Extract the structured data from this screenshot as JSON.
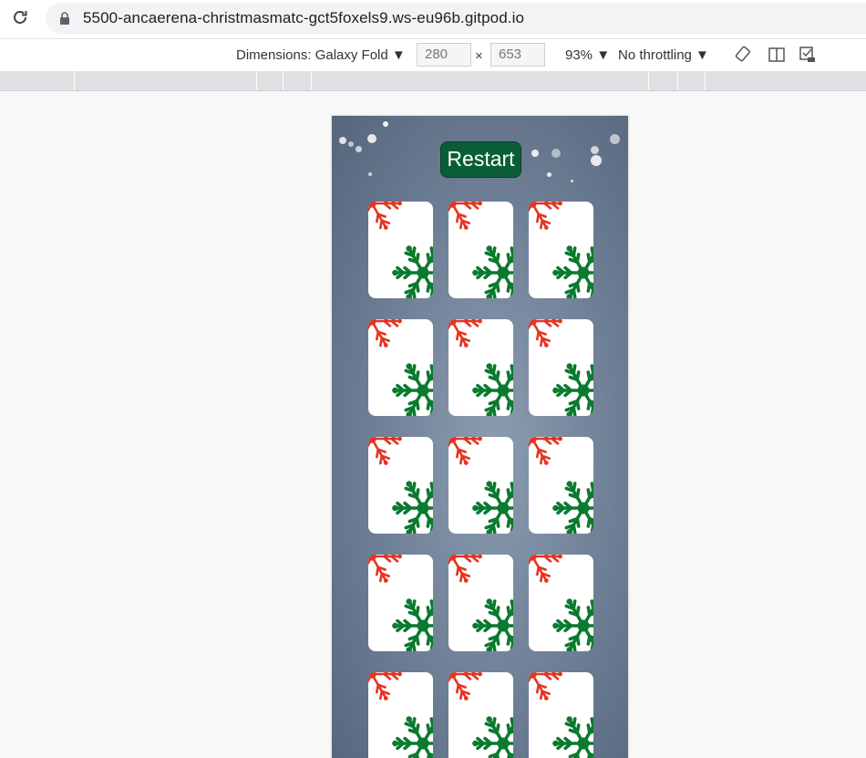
{
  "browser": {
    "url": "5500-ancaerena-christmasmatc-gct5foxels9.ws-eu96b.gitpod.io"
  },
  "device_toolbar": {
    "dimensions_label": "Dimensions: Galaxy Fold",
    "width": "280",
    "height": "653",
    "times": "×",
    "zoom": "93%",
    "throttling": "No throttling"
  },
  "game": {
    "restart_label": "Restart",
    "cards": [
      "card-back",
      "card-back",
      "card-back",
      "card-back",
      "card-back",
      "card-back",
      "card-back",
      "card-back",
      "card-back",
      "card-back",
      "card-back",
      "card-back",
      "card-back",
      "card-back",
      "card-back"
    ],
    "colors": {
      "button": "#0a5e36",
      "snowflake_red": "#e8321f",
      "snowflake_green": "#0b7a2e"
    }
  }
}
